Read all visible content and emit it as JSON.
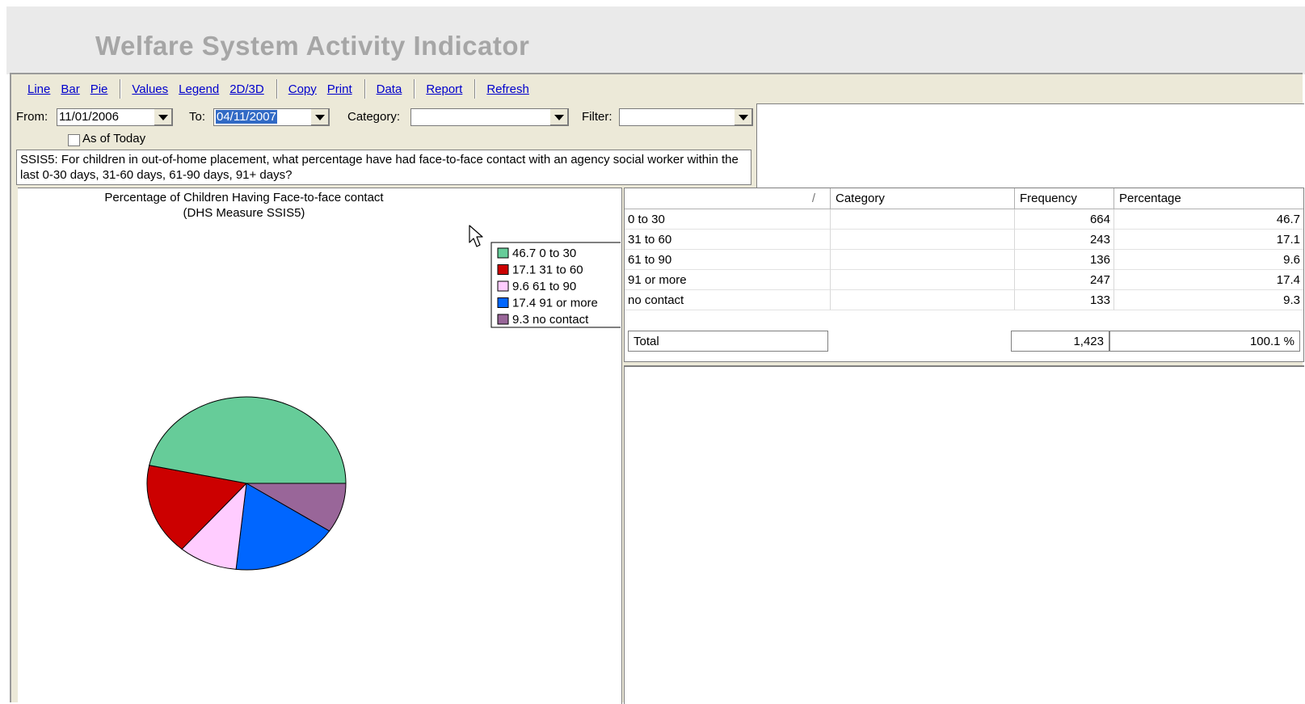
{
  "app": {
    "title": "Welfare System Activity Indicator"
  },
  "toolbar": {
    "line": "Line",
    "bar": "Bar",
    "pie": "Pie",
    "values": "Values",
    "legend": "Legend",
    "dim": "2D/3D",
    "copy": "Copy",
    "print": "Print",
    "data": "Data",
    "report": "Report",
    "refresh": "Refresh"
  },
  "filters": {
    "from_label": "From:",
    "from_value": "11/01/2006",
    "to_label": "To:",
    "to_value": "04/11/2007",
    "category_label": "Category:",
    "category_value": "",
    "filter_label": "Filter:",
    "filter_value": "",
    "as_of_today_label": "As of Today"
  },
  "description": "SSIS5: For children in out-of-home placement, what percentage have had face-to-face contact with an agency social worker within the last 0-30 days, 31-60 days, 61-90 days, 91+ days?",
  "chart_data": {
    "type": "pie",
    "title": "Percentage of Children Having Face-to-face contact",
    "subtitle": "(DHS Measure SSIS5)",
    "categories": [
      "0 to 30",
      "31 to 60",
      "61 to 90",
      "91 or more",
      "no contact"
    ],
    "values": [
      46.7,
      17.1,
      9.6,
      17.4,
      9.3
    ],
    "legend_labels": [
      "46.7 0 to 30",
      "17.1 31 to 60",
      "9.6 61 to 90",
      "17.4 91 or more",
      "9.3 no contact"
    ],
    "colors": [
      "#66cc99",
      "#cc0000",
      "#ffccff",
      "#0066ff",
      "#996699"
    ],
    "legend_position": "top-right"
  },
  "grid": {
    "columns": [
      "/",
      "Category",
      "Frequency",
      "Percentage"
    ],
    "rows": [
      {
        "label": "0 to 30",
        "category": "",
        "frequency": "664",
        "percentage": "46.7"
      },
      {
        "label": "31 to 60",
        "category": "",
        "frequency": "243",
        "percentage": "17.1"
      },
      {
        "label": "61 to 90",
        "category": "",
        "frequency": "136",
        "percentage": "9.6"
      },
      {
        "label": "91 or more",
        "category": "",
        "frequency": "247",
        "percentage": "17.4"
      },
      {
        "label": "no contact",
        "category": "",
        "frequency": "133",
        "percentage": "9.3"
      }
    ],
    "total_label": "Total",
    "total_frequency": "1,423",
    "total_percentage": "100.1 %"
  }
}
